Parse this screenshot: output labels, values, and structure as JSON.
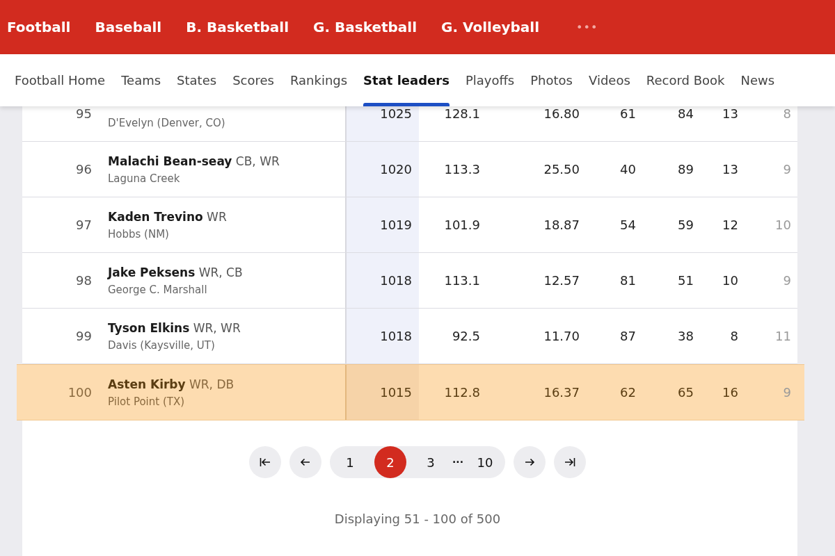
{
  "sport_tabs": [
    {
      "label": "Football"
    },
    {
      "label": "Baseball"
    },
    {
      "label": "B. Basketball"
    },
    {
      "label": "G. Basketball"
    },
    {
      "label": "G. Volleyball"
    }
  ],
  "more": "•••",
  "sub_nav": [
    {
      "label": "Football Home",
      "selected": false
    },
    {
      "label": "Teams",
      "selected": false
    },
    {
      "label": "States",
      "selected": false
    },
    {
      "label": "Scores",
      "selected": false
    },
    {
      "label": "Rankings",
      "selected": false
    },
    {
      "label": "Stat leaders",
      "selected": true
    },
    {
      "label": "Playoffs",
      "selected": false
    },
    {
      "label": "Photos",
      "selected": false
    },
    {
      "label": "Videos",
      "selected": false
    },
    {
      "label": "Record Book",
      "selected": false
    },
    {
      "label": "News",
      "selected": false
    }
  ],
  "table": {
    "columns": [
      {
        "sorted": true
      },
      {
        "sorted": false
      },
      {
        "sorted": false
      },
      {
        "sorted": false
      },
      {
        "sorted": false
      },
      {
        "sorted": false
      },
      {
        "sorted": false
      }
    ],
    "rows": [
      {
        "rank": "95",
        "school": "D'Evelyn (Denver, CO)",
        "highlighted": false,
        "cells": [
          "1025",
          "128.1",
          "16.80",
          "61",
          "84",
          "13",
          "8"
        ]
      },
      {
        "rank": "96",
        "name": "Malachi Bean-seay",
        "positions": "CB, WR",
        "school": "Laguna Creek",
        "highlighted": false,
        "cells": [
          "1020",
          "113.3",
          "25.50",
          "40",
          "89",
          "13",
          "9"
        ]
      },
      {
        "rank": "97",
        "name": "Kaden Trevino",
        "positions": "WR",
        "school": "Hobbs (NM)",
        "highlighted": false,
        "cells": [
          "1019",
          "101.9",
          "18.87",
          "54",
          "59",
          "12",
          "10"
        ]
      },
      {
        "rank": "98",
        "name": "Jake Peksens",
        "positions": "WR, CB",
        "school": "George C. Marshall",
        "highlighted": false,
        "cells": [
          "1018",
          "113.1",
          "12.57",
          "81",
          "51",
          "10",
          "9"
        ]
      },
      {
        "rank": "99",
        "name": "Tyson Elkins",
        "positions": "WR, WR",
        "school": "Davis (Kaysville, UT)",
        "highlighted": false,
        "cells": [
          "1018",
          "92.5",
          "11.70",
          "87",
          "38",
          "8",
          "11"
        ]
      },
      {
        "rank": "100",
        "name": "Asten Kirby",
        "positions": "WR, DB",
        "school": "Pilot Point (TX)",
        "highlighted": true,
        "cells": [
          "1015",
          "112.8",
          "16.37",
          "62",
          "65",
          "16",
          "9"
        ]
      }
    ]
  },
  "pagination": {
    "pages": [
      {
        "kind": "page",
        "label": "1",
        "selected": false
      },
      {
        "kind": "page",
        "label": "2",
        "selected": true
      },
      {
        "kind": "page",
        "label": "3",
        "selected": false
      },
      {
        "kind": "gap",
        "label": "···"
      },
      {
        "kind": "page",
        "label": "10",
        "selected": false
      }
    ],
    "summary": "Displaying 51 - 100 of 500"
  }
}
